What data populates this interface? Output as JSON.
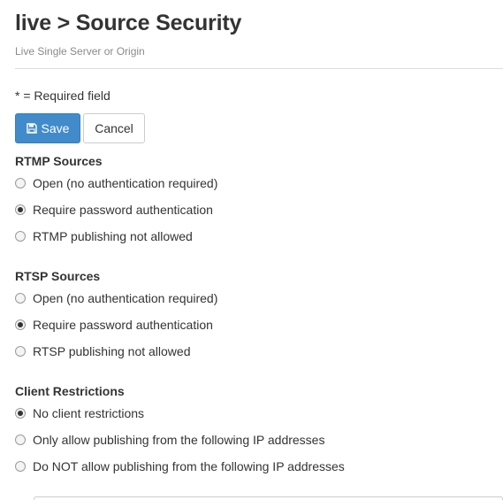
{
  "header": {
    "title": "live > Source Security",
    "subtitle": "Live Single Server or Origin"
  },
  "form": {
    "required_note": "* = Required field",
    "save_label": "Save",
    "cancel_label": "Cancel"
  },
  "rtmp": {
    "heading": "RTMP Sources",
    "options": [
      {
        "label": "Open (no authentication required)",
        "checked": false
      },
      {
        "label": "Require password authentication",
        "checked": true
      },
      {
        "label": "RTMP publishing not allowed",
        "checked": false
      }
    ]
  },
  "rtsp": {
    "heading": "RTSP Sources",
    "options": [
      {
        "label": "Open (no authentication required)",
        "checked": false
      },
      {
        "label": "Require password authentication",
        "checked": true
      },
      {
        "label": "RTSP publishing not allowed",
        "checked": false
      }
    ]
  },
  "client": {
    "heading": "Client Restrictions",
    "options": [
      {
        "label": "No client restrictions",
        "checked": true
      },
      {
        "label": "Only allow publishing from the following IP addresses",
        "checked": false
      },
      {
        "label": "Do NOT allow publishing from the following IP addresses",
        "checked": false
      }
    ]
  },
  "colors": {
    "primary_button": "#428bca",
    "text": "#333333",
    "muted": "#8a8a8a"
  }
}
